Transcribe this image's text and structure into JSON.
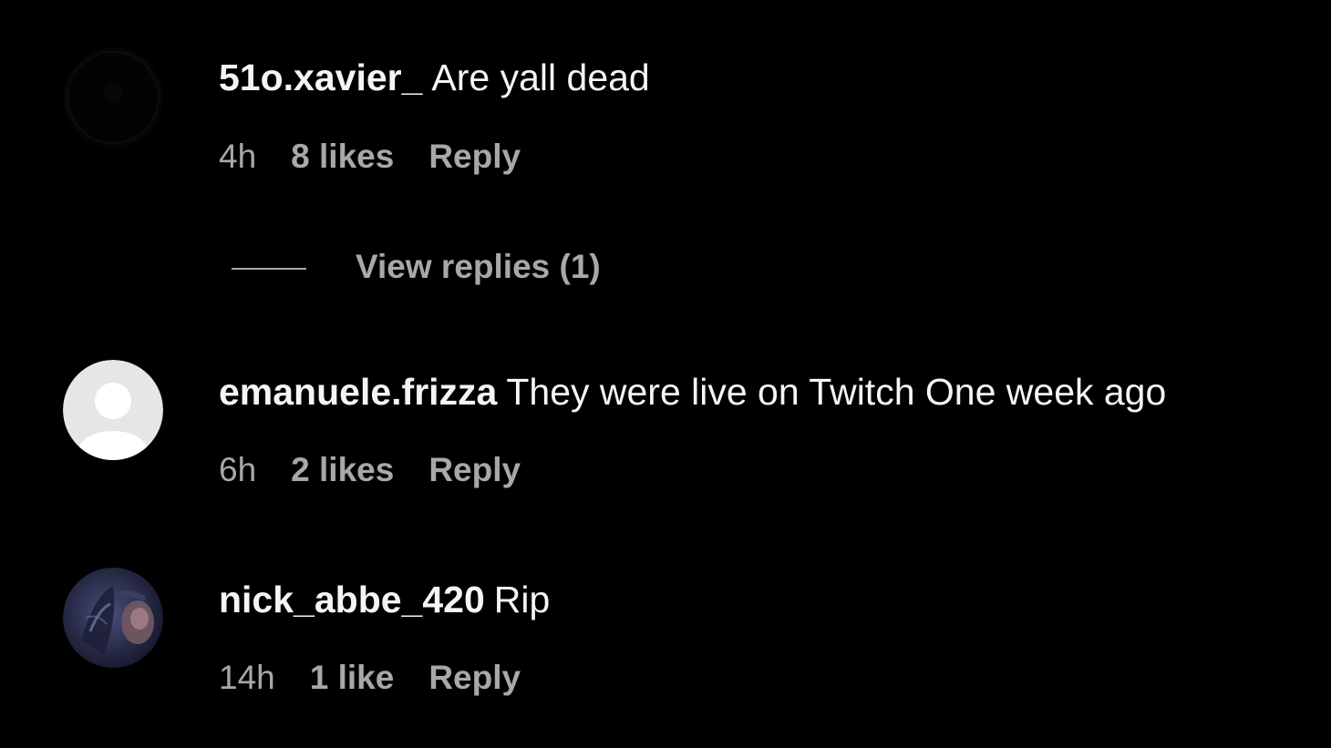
{
  "comments": [
    {
      "username": "51o.xavier_",
      "text": "Are yall dead",
      "time": "4h",
      "likes": "8 likes",
      "reply": "Reply",
      "avatar": "dark-avatar"
    },
    {
      "username": "emanuele.frizza",
      "text": "They were live on Twitch One week ago",
      "time": "6h",
      "likes": "2 likes",
      "reply": "Reply",
      "avatar": "default-avatar"
    },
    {
      "username": "nick_abbe_420",
      "text": "Rip",
      "time": "14h",
      "likes": "1 like",
      "reply": "Reply",
      "avatar": "photo-avatar"
    }
  ],
  "view_replies": "View replies (1)",
  "colors": {
    "background": "#000000",
    "primary_text": "#f5f5f5",
    "secondary_text": "#a8a8a8",
    "default_avatar_bg": "#e6e6e6"
  }
}
